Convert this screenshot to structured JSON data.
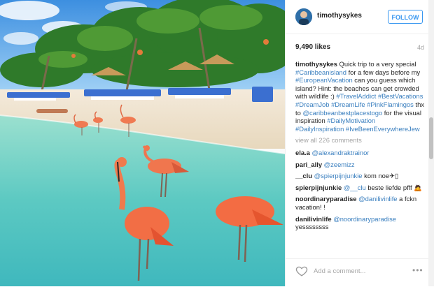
{
  "post": {
    "username": "timothysykes",
    "follow_label": "FOLLOW",
    "likes": "9,490 likes",
    "age": "4d"
  },
  "caption": {
    "username": "timothysykes",
    "parts": [
      {
        "t": "txt",
        "v": " Quick trip to a very special "
      },
      {
        "t": "tag",
        "v": "#Caribbeanisland"
      },
      {
        "t": "txt",
        "v": " for a few days before my "
      },
      {
        "t": "tag",
        "v": "#EuropeanVacation"
      },
      {
        "t": "txt",
        "v": " can you guess which island? Hint: the beaches can get crowded with wildlife :) "
      },
      {
        "t": "tag",
        "v": "#TravelAddict"
      },
      {
        "t": "txt",
        "v": " "
      },
      {
        "t": "tag",
        "v": "#BestVacations"
      },
      {
        "t": "txt",
        "v": " "
      },
      {
        "t": "tag",
        "v": "#DreamJob"
      },
      {
        "t": "txt",
        "v": " "
      },
      {
        "t": "tag",
        "v": "#DreamLife"
      },
      {
        "t": "txt",
        "v": " "
      },
      {
        "t": "tag",
        "v": "#PinkFlamingos"
      },
      {
        "t": "txt",
        "v": " thx to "
      },
      {
        "t": "tag",
        "v": "@caribbeanbestplacestogo"
      },
      {
        "t": "txt",
        "v": " for the visual inspiration "
      },
      {
        "t": "tag",
        "v": "#DailyMotivation"
      },
      {
        "t": "txt",
        "v": " "
      },
      {
        "t": "tag",
        "v": "#DailyInspiration"
      },
      {
        "t": "txt",
        "v": " "
      },
      {
        "t": "tag",
        "v": "#IveBeenEverywhereJew"
      }
    ]
  },
  "view_all": "view all 226 comments",
  "comments": [
    {
      "user": "ela.a",
      "parts": [
        {
          "t": "tag",
          "v": "@alexandraktrainor"
        }
      ]
    },
    {
      "user": "pari_ally",
      "parts": [
        {
          "t": "tag",
          "v": "@zeemizz"
        }
      ]
    },
    {
      "user": "__clu",
      "parts": [
        {
          "t": "tag",
          "v": "@spierpijnjunkie"
        },
        {
          "t": "txt",
          "v": " kom noe✈▯"
        }
      ]
    },
    {
      "user": "spierpijnjunkie",
      "parts": [
        {
          "t": "tag",
          "v": "@__clu"
        },
        {
          "t": "txt",
          "v": " beste liefde pfff 🙇"
        }
      ]
    },
    {
      "user": "noordinaryparadise",
      "parts": [
        {
          "t": "tag",
          "v": "@danilivinlife"
        },
        {
          "t": "txt",
          "v": " a fckn vacation! !"
        }
      ]
    },
    {
      "user": "danilivinlife",
      "parts": [
        {
          "t": "tag",
          "v": "@noordinaryparadise"
        },
        {
          "t": "txt",
          "v": " yessssssss"
        }
      ]
    }
  ],
  "add_comment_placeholder": "Add a comment...",
  "more_label": "•••",
  "colors": {
    "link": "#3a7fbf",
    "follow": "#3897f0",
    "muted": "#a5a5a5"
  }
}
